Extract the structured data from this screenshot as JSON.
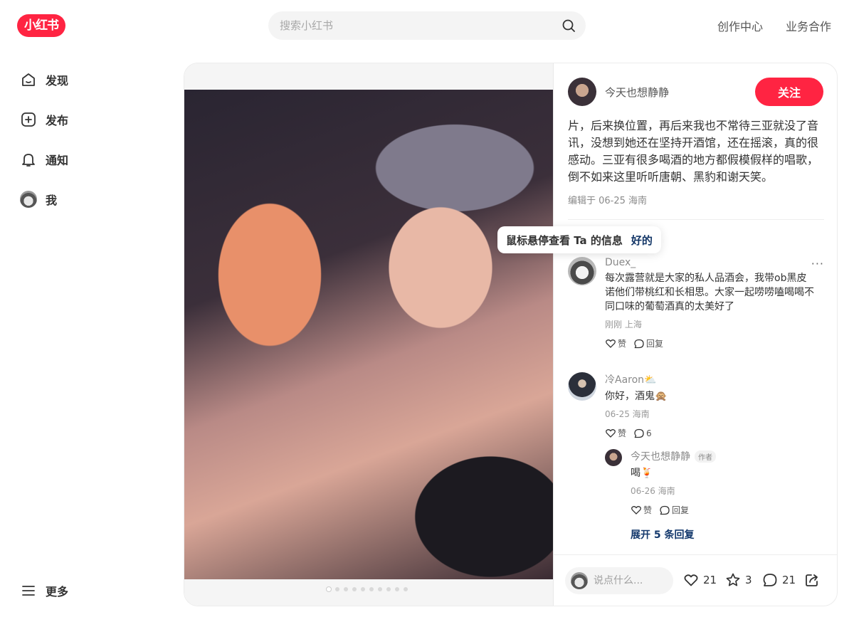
{
  "header": {
    "logo": "小红书",
    "search_placeholder": "搜索小红书",
    "links": [
      "创作中心",
      "业务合作"
    ]
  },
  "sidebar": {
    "items": [
      {
        "label": "发现",
        "icon": "home-icon"
      },
      {
        "label": "发布",
        "icon": "plus-square-icon"
      },
      {
        "label": "通知",
        "icon": "bell-icon"
      },
      {
        "label": "我",
        "icon": "avatar"
      }
    ],
    "more": "更多"
  },
  "media": {
    "image_count": 10,
    "active_index": 0
  },
  "note": {
    "author": "今天也想静静",
    "follow_label": "关注",
    "description": "片，后来换位置，再后来我也不常待三亚就没了音讯，没想到她还在坚持开酒馆，还在摇滚，真的很感动。三亚有很多喝酒的地方都假模假样的唱歌，倒不如来这里听听唐朝、黑豹和谢天笑。",
    "edited": "编辑于 06-25 海南"
  },
  "tooltip": {
    "text": "鼠标悬停查看 Ta 的信息",
    "ok": "好的"
  },
  "comments": [
    {
      "user": "Duex_",
      "text": "每次露营就是大家的私人品酒会，我带ob黑皮诺他们带桃红和长相思。大家一起唠唠嗑喝喝不同口味的葡萄酒真的太美好了",
      "meta": "刚刚 上海",
      "like_label": "赞",
      "reply_label": "回复"
    },
    {
      "user": "冷Aaron⛅",
      "text": "你好，酒鬼🙊",
      "meta": "06-25 海南",
      "like_label": "赞",
      "reply_count": "6",
      "replies": [
        {
          "user": "今天也想静静",
          "badge": "作者",
          "text": "喝🍹",
          "meta": "06-26 海南",
          "like_label": "赞",
          "reply_label": "回复"
        }
      ],
      "expand": "展开 5 条回复"
    }
  ],
  "footer": {
    "input_placeholder": "说点什么...",
    "likes": "21",
    "collects": "3",
    "comments": "21"
  },
  "colors": {
    "brand": "#ff2442",
    "link": "#133667"
  }
}
